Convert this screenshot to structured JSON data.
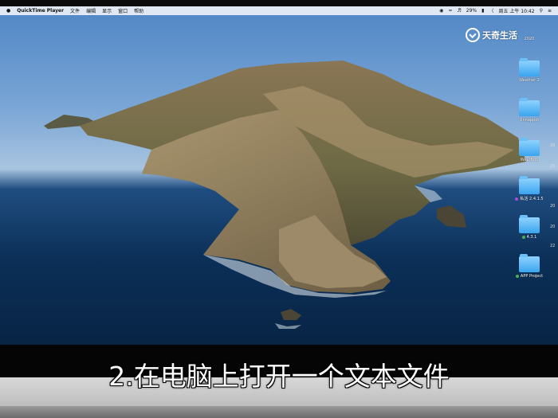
{
  "menubar": {
    "app_name": "QuickTime Player",
    "menus": [
      "文件",
      "编辑",
      "显示",
      "窗口",
      "帮助"
    ],
    "battery": "29%",
    "datetime": "周五 上午 10:42"
  },
  "watermark": {
    "text": "天奇生活"
  },
  "desktop": {
    "top_label": "2020",
    "items": [
      {
        "label": "Weather 2",
        "tag": ""
      },
      {
        "label": "Unnappot",
        "tag": ""
      },
      {
        "label": "WeatBob",
        "tag": ""
      },
      {
        "label": "私活 2.4.1.5",
        "tag": "purple"
      },
      {
        "label": "4.3.1",
        "tag": "green"
      },
      {
        "label": "APP Project",
        "tag": "green"
      }
    ],
    "edge_numbers": [
      "20",
      "20",
      "20",
      "20",
      "22"
    ]
  },
  "subtitle": {
    "text": "2.在电脑上打开一个文本文件"
  },
  "colors": {
    "folder": "#3aa4ee",
    "menubar_bg": "#ebf0f6",
    "bezel": "#c8c8c8"
  }
}
